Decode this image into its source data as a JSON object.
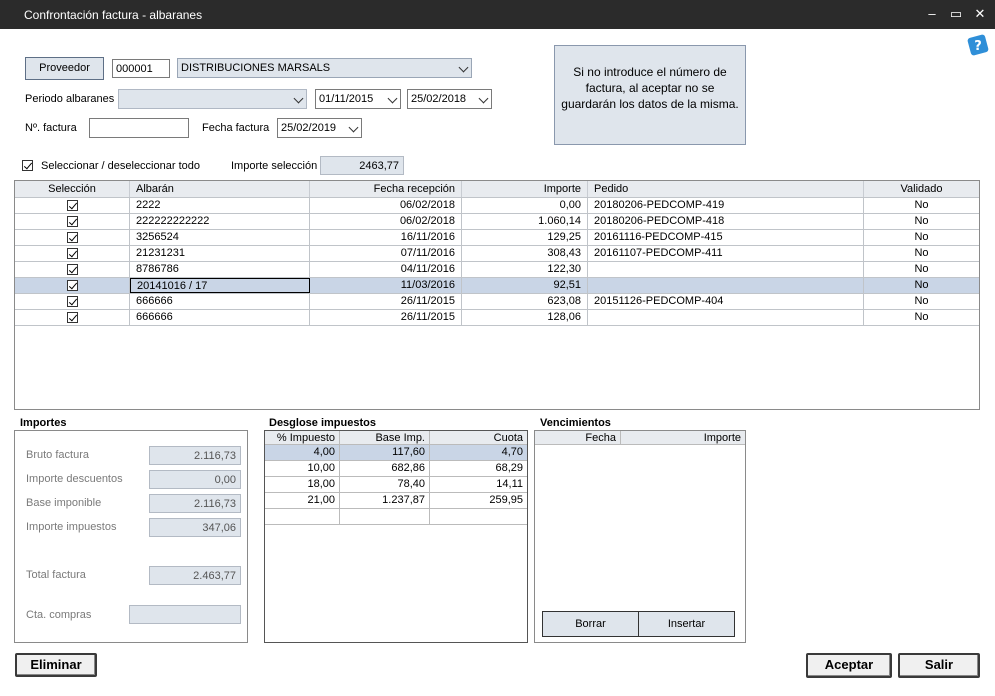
{
  "window": {
    "title": "Confrontación factura - albaranes",
    "minimize": "–",
    "maximize": "▭",
    "close": "✕"
  },
  "header": {
    "proveedor_button": "Proveedor",
    "proveedor_code": "000001",
    "proveedor_name": "DISTRIBUCIONES MARSALS",
    "periodo_label": "Periodo albaranes",
    "periodo_from": "01/11/2015",
    "periodo_to": "25/02/2018",
    "nfactura_label": "Nº. factura",
    "nfactura_value": "",
    "fecha_factura_label": "Fecha factura",
    "fecha_factura_value": "25/02/2019",
    "note": "Si no introduce el número de factura, al aceptar no se guardarán los datos de la misma.",
    "select_all_label": "Seleccionar / deseleccionar todo",
    "importe_seleccion_label": "Importe selección",
    "importe_seleccion_value": "2463,77"
  },
  "grid": {
    "columns": [
      "Selección",
      "Albarán",
      "Fecha recepción",
      "Importe",
      "Pedido",
      "Validado"
    ],
    "rows": [
      {
        "albaran": "2222",
        "fecha": "06/02/2018",
        "importe": "0,00",
        "pedido": "20180206-PEDCOMP-419",
        "validado": "No"
      },
      {
        "albaran": "222222222222",
        "fecha": "06/02/2018",
        "importe": "1.060,14",
        "pedido": "20180206-PEDCOMP-418",
        "validado": "No"
      },
      {
        "albaran": "3256524",
        "fecha": "16/11/2016",
        "importe": "129,25",
        "pedido": "20161116-PEDCOMP-415",
        "validado": "No"
      },
      {
        "albaran": "21231231",
        "fecha": "07/11/2016",
        "importe": "308,43",
        "pedido": "20161107-PEDCOMP-411",
        "validado": "No"
      },
      {
        "albaran": "8786786",
        "fecha": "04/11/2016",
        "importe": "122,30",
        "pedido": "",
        "validado": "No"
      },
      {
        "albaran": "20141016 / 17",
        "fecha": "11/03/2016",
        "importe": "92,51",
        "pedido": "",
        "validado": "No"
      },
      {
        "albaran": "666666",
        "fecha": "26/11/2015",
        "importe": "623,08",
        "pedido": "20151126-PEDCOMP-404",
        "validado": "No"
      },
      {
        "albaran": "666666",
        "fecha": "26/11/2015",
        "importe": "128,06",
        "pedido": "",
        "validado": "No"
      }
    ]
  },
  "importes": {
    "title": "Importes",
    "bruto_label": "Bruto factura",
    "bruto": "2.116,73",
    "descuentos_label": "Importe descuentos",
    "descuentos": "0,00",
    "base_label": "Base imponible",
    "base": "2.116,73",
    "impuestos_label": "Importe impuestos",
    "impuestos": "347,06",
    "total_label": "Total factura",
    "total": "2.463,77",
    "cta_label": "Cta. compras",
    "cta": ""
  },
  "desglose": {
    "title": "Desglose impuestos",
    "columns": [
      "% Impuesto",
      "Base Imp.",
      "Cuota"
    ],
    "rows": [
      {
        "pct": "4,00",
        "base": "117,60",
        "cuota": "4,70"
      },
      {
        "pct": "10,00",
        "base": "682,86",
        "cuota": "68,29"
      },
      {
        "pct": "18,00",
        "base": "78,40",
        "cuota": "14,11"
      },
      {
        "pct": "21,00",
        "base": "1.237,87",
        "cuota": "259,95"
      }
    ]
  },
  "vencimientos": {
    "title": "Vencimientos",
    "columns": [
      "Fecha",
      "Importe"
    ],
    "borrar": "Borrar",
    "insertar": "Insertar"
  },
  "footer": {
    "eliminar": "Eliminar",
    "aceptar": "Aceptar",
    "salir": "Salir"
  },
  "colors": {
    "titlebar": "#2b2b2b",
    "selected_row": "#c9d5e6",
    "readonly_bg": "#dfe5ec"
  }
}
